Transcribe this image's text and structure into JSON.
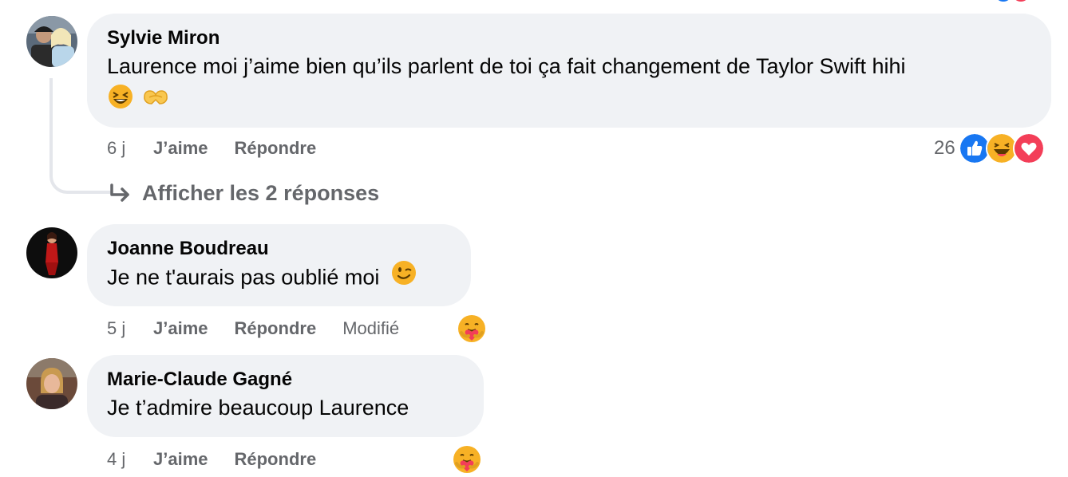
{
  "comments": [
    {
      "author": "Sylvie Miron",
      "text": "Laurence moi j’aime bien qu’ils parlent de toi ça fait changement de Taylor Swift hihi",
      "emojis": [
        "laughing-face",
        "heart-hands"
      ],
      "time": "6 j",
      "like_label": "J’aime",
      "reply_label": "Répondre",
      "reaction_count": "26",
      "reactions": [
        "like",
        "haha",
        "love"
      ],
      "show_replies": "Afficher les 2 réponses"
    },
    {
      "author": "Joanne Boudreau",
      "text": "Je ne t'aurais pas oublié moi",
      "emojis": [
        "winking-face"
      ],
      "time": "5 j",
      "like_label": "J’aime",
      "reply_label": "Répondre",
      "edited_label": "Modifié",
      "reactions": [
        "care"
      ]
    },
    {
      "author": "Marie-Claude Gagné",
      "text": "Je t’admire beaucoup Laurence",
      "time": "4 j",
      "like_label": "J’aime",
      "reply_label": "Répondre",
      "reactions": [
        "care"
      ]
    }
  ],
  "colors": {
    "bubble": "#f0f2f5",
    "meta_text": "#65676b",
    "like_blue": "#1877f2",
    "love_red": "#f33e58",
    "emoji_yellow": "#f7b125"
  }
}
